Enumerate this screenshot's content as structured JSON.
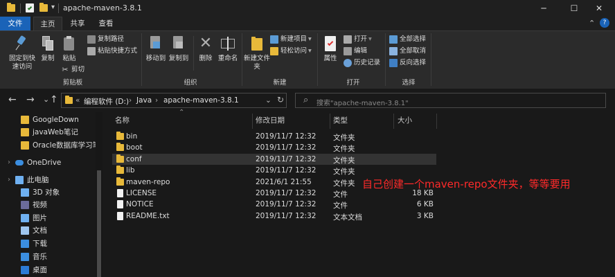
{
  "window": {
    "title": "apache-maven-3.8.1",
    "minimize_glyph": "─",
    "maximize_glyph": "☐",
    "close_glyph": "✕",
    "qa_dropdown_glyph": "▾"
  },
  "tabs": {
    "file": "文件",
    "home": "主页",
    "share": "共享",
    "view": "查看"
  },
  "ribbon": {
    "clipboard": {
      "pin_label": "固定到快速访问",
      "copy_label": "复制",
      "paste_label": "粘贴",
      "copy_path_label": "复制路径",
      "paste_shortcut_label": "粘贴快捷方式",
      "cut_label": "剪切",
      "group_label": "剪贴板"
    },
    "organize": {
      "move_to_label": "移动到",
      "copy_to_label": "复制到",
      "delete_label": "删除",
      "rename_label": "重命名",
      "group_label": "组织"
    },
    "new": {
      "new_folder_label": "新建文件夹",
      "new_item_label": "新建项目",
      "easy_access_label": "轻松访问",
      "group_label": "新建"
    },
    "open": {
      "properties_label": "属性",
      "open_label": "打开",
      "edit_label": "编辑",
      "history_label": "历史记录",
      "group_label": "打开"
    },
    "select": {
      "select_all_label": "全部选择",
      "select_none_label": "全部取消",
      "invert_label": "反向选择",
      "group_label": "选择"
    },
    "collapse_glyph": "⌃",
    "help_glyph": "?"
  },
  "address": {
    "back_glyph": "←",
    "forward_glyph": "→",
    "recent_glyph": "⌄",
    "up_glyph": "↑",
    "overflow": "«",
    "crumbs": [
      "编程软件 (D:)",
      "Java",
      "apache-maven-3.8.1"
    ],
    "crumb_sep": "›",
    "dropdown_glyph": "⌄",
    "refresh_glyph": "↻",
    "search_placeholder": "搜索\"apache-maven-3.8.1\"",
    "search_glyph": "⌕"
  },
  "navpane": {
    "items": [
      {
        "label": "GoogleDown",
        "icon": "folder-icon"
      },
      {
        "label": "javaWeb笔记",
        "icon": "folder-icon"
      },
      {
        "label": "Oracle数据库学习笔记",
        "icon": "folder-icon"
      },
      {
        "label": "OneDrive",
        "icon": "cloud-icon"
      },
      {
        "label": "此电脑",
        "icon": "computer-icon"
      },
      {
        "label": "3D 对象",
        "icon": "cube-icon"
      },
      {
        "label": "视频",
        "icon": "video-icon"
      },
      {
        "label": "图片",
        "icon": "picture-icon"
      },
      {
        "label": "文档",
        "icon": "document-icon"
      },
      {
        "label": "下载",
        "icon": "download-icon"
      },
      {
        "label": "音乐",
        "icon": "music-icon"
      },
      {
        "label": "桌面",
        "icon": "desktop-icon"
      }
    ],
    "expand_glyph": "›"
  },
  "filelist": {
    "sort_glyph": "⌃",
    "columns": {
      "name": "名称",
      "modified": "修改日期",
      "type": "类型",
      "size": "大小"
    },
    "rows": [
      {
        "name": "bin",
        "date": "2019/11/7 12:32",
        "type": "文件夹",
        "size": "",
        "kind": "folder"
      },
      {
        "name": "boot",
        "date": "2019/11/7 12:32",
        "type": "文件夹",
        "size": "",
        "kind": "folder"
      },
      {
        "name": "conf",
        "date": "2019/11/7 12:32",
        "type": "文件夹",
        "size": "",
        "kind": "folder"
      },
      {
        "name": "lib",
        "date": "2019/11/7 12:32",
        "type": "文件夹",
        "size": "",
        "kind": "folder"
      },
      {
        "name": "maven-repo",
        "date": "2021/6/1 21:55",
        "type": "文件夹",
        "size": "",
        "kind": "folder"
      },
      {
        "name": "LICENSE",
        "date": "2019/11/7 12:32",
        "type": "文件",
        "size": "18 KB",
        "kind": "file"
      },
      {
        "name": "NOTICE",
        "date": "2019/11/7 12:32",
        "type": "文件",
        "size": "6 KB",
        "kind": "file"
      },
      {
        "name": "README.txt",
        "date": "2019/11/7 12:32",
        "type": "文本文档",
        "size": "3 KB",
        "kind": "file"
      }
    ]
  },
  "annotation": "自己创建一个maven-repo文件夹，等等要用",
  "colors": {
    "accent": "#1a63b8",
    "folder": "#e8b93a",
    "annotation": "#ff2a2a",
    "background": "#191919"
  }
}
